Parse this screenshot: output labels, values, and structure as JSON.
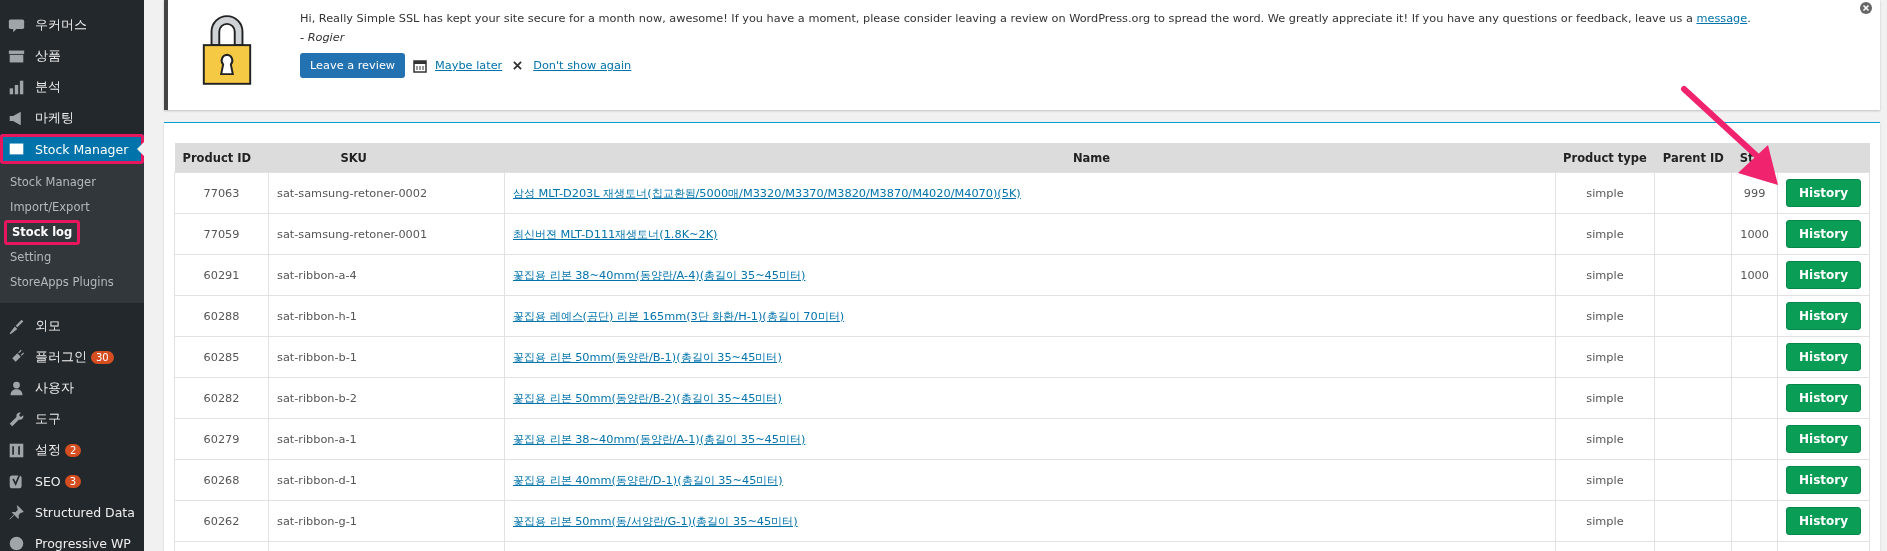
{
  "sidebar": {
    "items": [
      {
        "label": "우커머스",
        "kind": "woo",
        "selected": false,
        "highlighted": false
      },
      {
        "label": "상품",
        "kind": "box",
        "selected": false,
        "highlighted": false
      },
      {
        "label": "분석",
        "kind": "bars",
        "selected": false,
        "highlighted": false
      },
      {
        "label": "마케팅",
        "kind": "megaphone",
        "selected": false,
        "highlighted": false
      },
      {
        "label": "Stock Manager",
        "kind": "book",
        "selected": true,
        "highlighted": true,
        "children": [
          {
            "label": "Stock Manager",
            "selected": false,
            "highlighted": false
          },
          {
            "label": "Import/Export",
            "selected": false,
            "highlighted": false
          },
          {
            "label": "Stock log",
            "selected": true,
            "highlighted": true
          },
          {
            "label": "Setting",
            "selected": false,
            "highlighted": false
          },
          {
            "label": "StoreApps Plugins",
            "selected": false,
            "highlighted": false
          }
        ]
      },
      {
        "label": "외모",
        "kind": "brush",
        "selected": false,
        "highlighted": false
      },
      {
        "label": "플러그인",
        "kind": "plug",
        "selected": false,
        "highlighted": false,
        "badge": "30"
      },
      {
        "label": "사용자",
        "kind": "user",
        "selected": false,
        "highlighted": false
      },
      {
        "label": "도구",
        "kind": "wrench",
        "selected": false,
        "highlighted": false
      },
      {
        "label": "설정",
        "kind": "sliders",
        "selected": false,
        "highlighted": false,
        "badge": "2"
      },
      {
        "label": "SEO",
        "kind": "yoast",
        "selected": false,
        "highlighted": false,
        "badge": "3"
      },
      {
        "label": "Structured Data",
        "kind": "pin",
        "selected": false,
        "highlighted": false
      },
      {
        "label": "Progressive WP",
        "kind": "circle",
        "selected": false,
        "highlighted": false
      }
    ]
  },
  "notice": {
    "message": "Hi, Really Simple SSL has kept your site secure for a month now, awesome! If you have a moment, please consider leaving a review on WordPress.org to spread the word. We greatly appreciate it! If you have any questions or feedback, leave us a",
    "link": "message",
    "after": ".",
    "signature": "- Rogier",
    "review_button": "Leave a review",
    "maybe_later": "Maybe later",
    "dont_show": "Don't show again"
  },
  "table": {
    "columns": [
      "Product ID",
      "SKU",
      "Name",
      "Product type",
      "Parent ID",
      "St"
    ],
    "rows": [
      {
        "product_id": "77063",
        "sku": "sat-samsung-retoner-0002",
        "name": "삼성 MLT-D203L 재생토너(칩교환됨/5000매/M3320/M3370/M3820/M3870/M4020/M4070)(5K)",
        "type": "simple",
        "parent_id": "",
        "stock": "999",
        "action": "History"
      },
      {
        "product_id": "77059",
        "sku": "sat-samsung-retoner-0001",
        "name": "최신버젼 MLT-D111재생토너(1.8K~2K)",
        "type": "simple",
        "parent_id": "",
        "stock": "1000",
        "action": "History"
      },
      {
        "product_id": "60291",
        "sku": "sat-ribbon-a-4",
        "name": "꽃집용 리본 38~40mm(동양란/A-4)(총길이 35~45미터)",
        "type": "simple",
        "parent_id": "",
        "stock": "1000",
        "action": "History"
      },
      {
        "product_id": "60288",
        "sku": "sat-ribbon-h-1",
        "name": "꽃집용 레예스(공단) 리본 165mm(3단 화환/H-1)(총길이 70미터)",
        "type": "simple",
        "parent_id": "",
        "stock": "",
        "action": "History"
      },
      {
        "product_id": "60285",
        "sku": "sat-ribbon-b-1",
        "name": "꽃집용 리본 50mm(동양란/B-1)(총길이 35~45미터)",
        "type": "simple",
        "parent_id": "",
        "stock": "",
        "action": "History"
      },
      {
        "product_id": "60282",
        "sku": "sat-ribbon-b-2",
        "name": "꽃집용 리본 50mm(동양란/B-2)(총길이 35~45미터)",
        "type": "simple",
        "parent_id": "",
        "stock": "",
        "action": "History"
      },
      {
        "product_id": "60279",
        "sku": "sat-ribbon-a-1",
        "name": "꽃집용 리본 38~40mm(동양란/A-1)(총길이 35~45미터)",
        "type": "simple",
        "parent_id": "",
        "stock": "",
        "action": "History"
      },
      {
        "product_id": "60268",
        "sku": "sat-ribbon-d-1",
        "name": "꽃집용 리본 40mm(동양란/D-1)(총길이 35~45미터)",
        "type": "simple",
        "parent_id": "",
        "stock": "",
        "action": "History"
      },
      {
        "product_id": "60262",
        "sku": "sat-ribbon-g-1",
        "name": "꽃집용 리본 50mm(동/서양란/G-1)(총길이 35~45미터)",
        "type": "simple",
        "parent_id": "",
        "stock": "",
        "action": "History"
      }
    ]
  }
}
